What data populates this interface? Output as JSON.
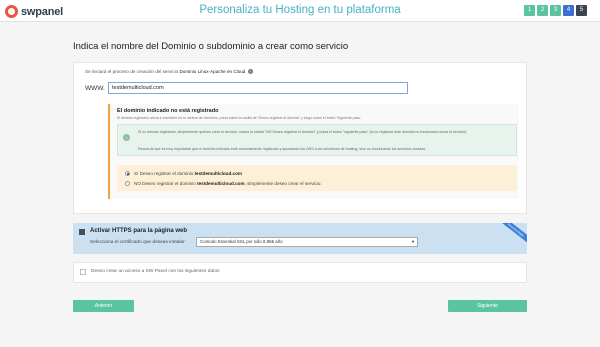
{
  "header": {
    "logo_text": "swpanel",
    "title": "Personaliza tu Hosting en tu plataforma",
    "steps": [
      "1",
      "2",
      "3",
      "4",
      "5"
    ],
    "active_step": "4",
    "colors": {
      "accent": "#48b0c4",
      "done": "#5ac49f",
      "active": "#3a6fd6",
      "pending": "#3d4450"
    }
  },
  "page": {
    "title": "Indica el nombre del Dominio o subdominio a crear como servicio"
  },
  "domain": {
    "info_prefix": "Se iniciará el proceso de creación del servicio",
    "info_service": "Dominio Linux-Apache en Cloud",
    "help_icon": "?",
    "www_label": "WWW.",
    "input_value": "testdemulticloud.com"
  },
  "registration": {
    "title": "El dominio indicado no está registrado",
    "subtitle": "Si deseas registrarlo ahora e insertarlo en tu cartera de dominios, pulsa sobre la casilla de 'Deseo registrar el dominio' y luego sobre el botón 'Siguiente paso'.",
    "note_icon": "i",
    "note_text": "Si no deseas registrarlo, simplemente quieres crear el servicio, marca la casilla \"NO Deseo registrar el dominio\" y pulsa el botón \"siguiente paso\" (si no registras este dominio no funcionará nunca el servicio).",
    "note_extra": "Recuerda que es muy importante que el dominio indicado esté correctamente registrado y apuntando las DNS a los servidores de hosting, sino no funcionarán los servicios creados.",
    "option_yes_prefix": "Sí Deseo registrar el dominio",
    "option_yes_domain": "testdemulticloud.com",
    "option_no_prefix": "NO Deseo registrar el dominio",
    "option_no_domain": "testdemulticloud.com",
    "option_no_suffix": ", simplemente deseo crear el servicio."
  },
  "https": {
    "title": "Activar HTTPS para la página web",
    "cert_label": "Selecciona el certificado que deseas instalar",
    "cert_selected": "Comodo Essential SSL por sólo 8,95€ año",
    "ribbon": "Recomendado"
  },
  "access": {
    "label": "Deseo crear un acceso a SW Panel con los siguientes datos"
  },
  "buttons": {
    "previous": "Anterior",
    "next": "Siguiente"
  }
}
